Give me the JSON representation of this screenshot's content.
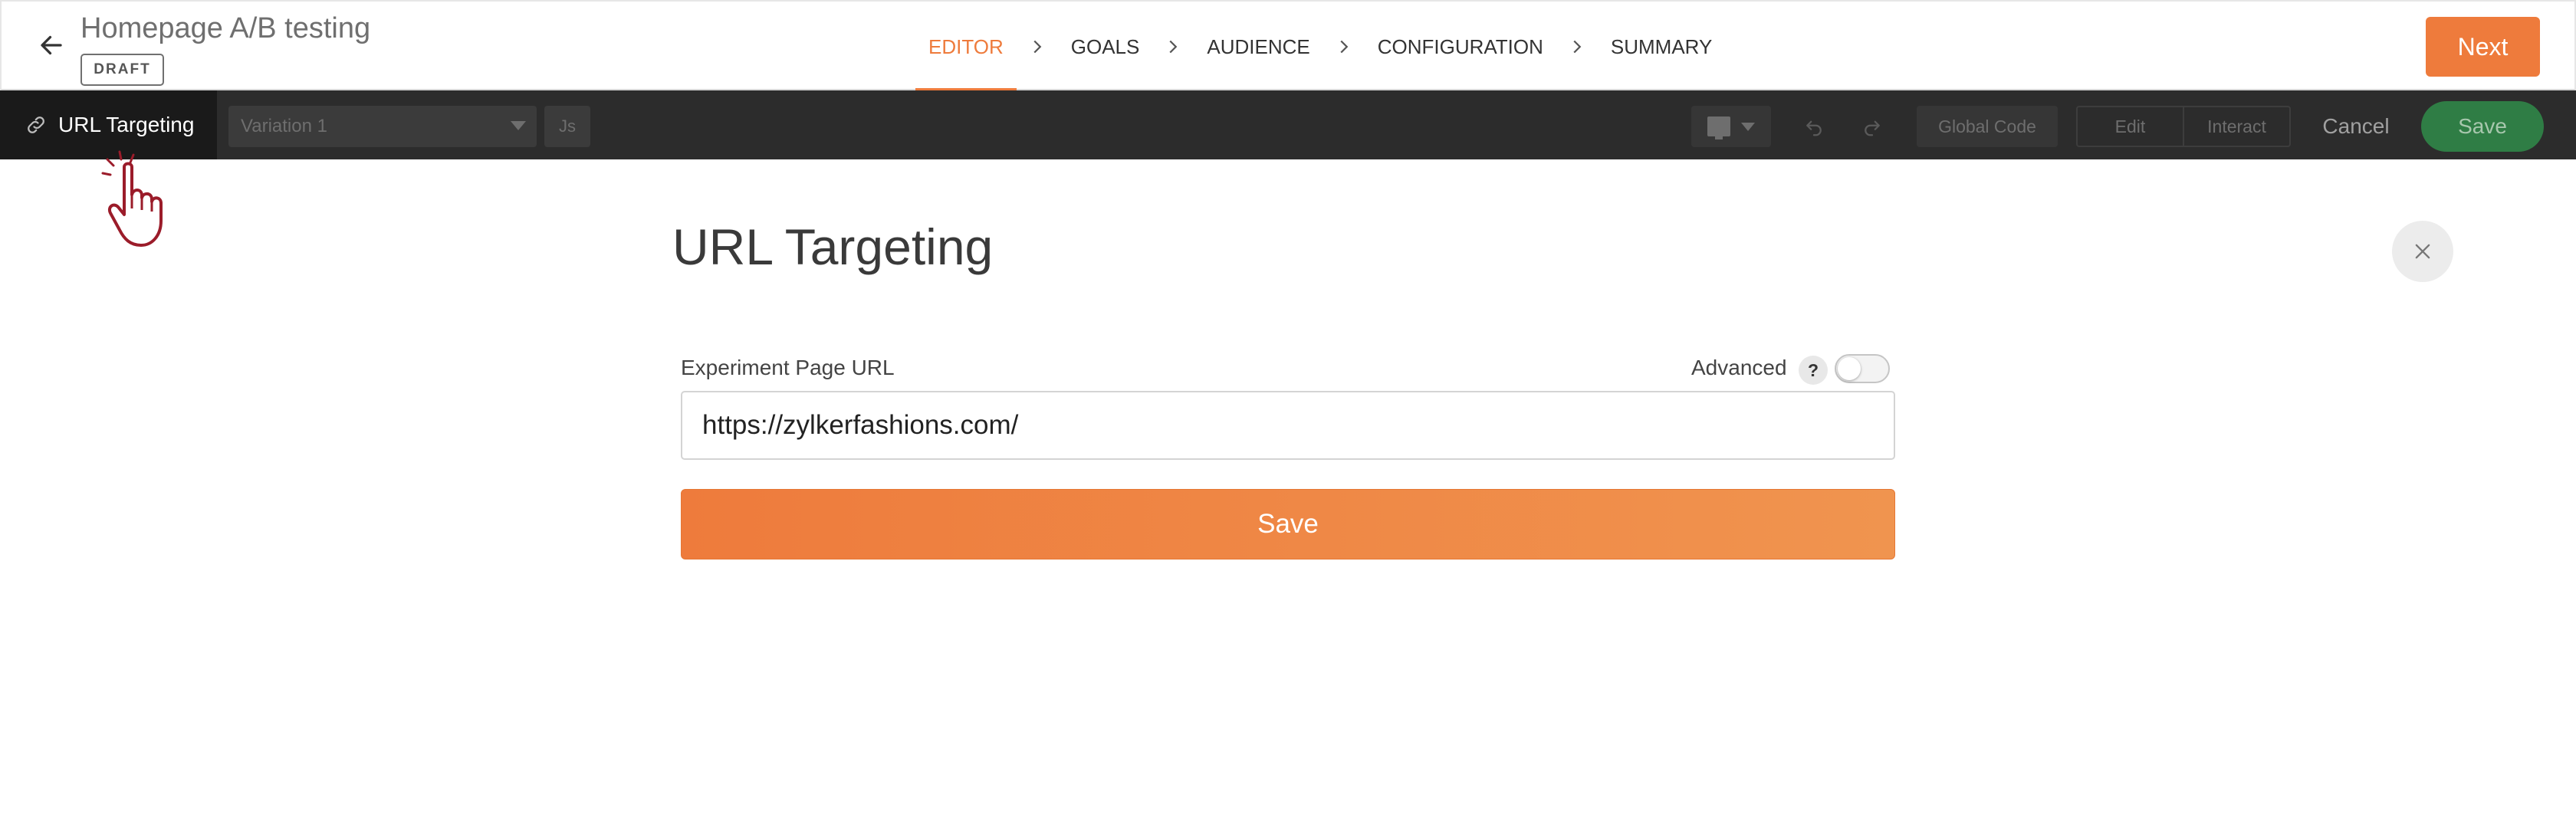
{
  "header": {
    "title": "Homepage A/B testing",
    "status_badge": "DRAFT",
    "steps": [
      {
        "label": "EDITOR",
        "active": true
      },
      {
        "label": "GOALS",
        "active": false
      },
      {
        "label": "AUDIENCE",
        "active": false
      },
      {
        "label": "CONFIGURATION",
        "active": false
      },
      {
        "label": "SUMMARY",
        "active": false
      }
    ],
    "next_label": "Next",
    "back_icon": "arrow-left-icon"
  },
  "toolbar": {
    "url_targeting_label": "URL Targeting",
    "variation_select_value": "Variation 1",
    "js_label": "Js",
    "device_icon": "desktop-monitor-icon",
    "global_code_label": "Global Code",
    "mode_edit_label": "Edit",
    "mode_interact_label": "Interact",
    "cancel_label": "Cancel",
    "save_label": "Save"
  },
  "panel": {
    "heading": "URL Targeting",
    "field_label": "Experiment Page URL",
    "advanced_label": "Advanced",
    "help_glyph": "?",
    "advanced_enabled": false,
    "url_value": "https://zylkerfashions.com/",
    "save_label": "Save"
  },
  "colors": {
    "accent": "#ee7b3c",
    "toolbar_bg": "#2c2c2c",
    "toolbar_save_bg": "#2f7d45"
  }
}
